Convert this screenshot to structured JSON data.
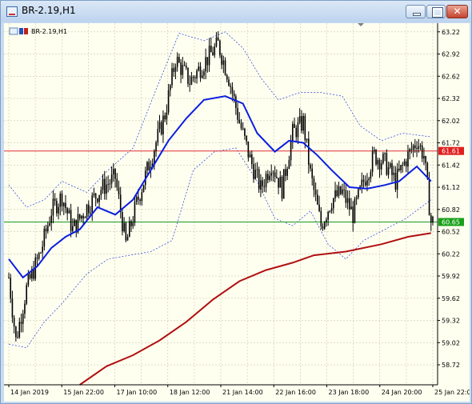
{
  "window": {
    "title": "BR-2.19,H1",
    "close_glyph": "✕"
  },
  "chart_header": {
    "symbol_label": "BR-2.19,H1",
    "icons": [
      "chart-window-icon",
      "bar-chart-icon"
    ]
  },
  "colors": {
    "background": "#fffff0",
    "grid": "#c8c8a8",
    "candle": "#000000",
    "ma_fast": "#0a1ee0",
    "ma_slow": "#b01010",
    "bands": "#1e3cdc",
    "resistance_line": "#e03030",
    "support_line": "#1a9a1a",
    "price_tag_red": "#e02020",
    "price_tag_green": "#18a018"
  },
  "chart_data": {
    "type": "candlestick",
    "title": "BR-2.19,H1",
    "y_ticks": [
      63.22,
      62.92,
      62.62,
      62.32,
      62.02,
      61.72,
      61.42,
      61.12,
      60.82,
      60.52,
      60.22,
      59.92,
      59.62,
      59.32,
      59.02,
      58.72
    ],
    "ylim": [
      58.45,
      63.25
    ],
    "x_ticks": [
      "14 Jan 2019",
      "15 Jan 22:00",
      "17 Jan 10:00",
      "18 Jan 12:00",
      "21 Jan 14:00",
      "22 Jan 16:00",
      "23 Jan 18:00",
      "24 Jan 20:00",
      "25 Jan 22:00"
    ],
    "hlines": [
      {
        "label": "61.61",
        "value": 61.61,
        "color": "#e03030"
      },
      {
        "label": "60.65",
        "value": 60.65,
        "color": "#1a9a1a"
      }
    ],
    "price_path": [
      {
        "bar": 0,
        "price": 59.9
      },
      {
        "bar": 4,
        "price": 59.05
      },
      {
        "bar": 10,
        "price": 59.75
      },
      {
        "bar": 18,
        "price": 60.25
      },
      {
        "bar": 24,
        "price": 60.8
      },
      {
        "bar": 30,
        "price": 61.0
      },
      {
        "bar": 36,
        "price": 60.55
      },
      {
        "bar": 44,
        "price": 60.85
      },
      {
        "bar": 52,
        "price": 61.1
      },
      {
        "bar": 60,
        "price": 61.25
      },
      {
        "bar": 66,
        "price": 60.35
      },
      {
        "bar": 72,
        "price": 60.9
      },
      {
        "bar": 80,
        "price": 61.5
      },
      {
        "bar": 88,
        "price": 62.1
      },
      {
        "bar": 94,
        "price": 62.85
      },
      {
        "bar": 102,
        "price": 62.55
      },
      {
        "bar": 110,
        "price": 62.8
      },
      {
        "bar": 118,
        "price": 63.05
      },
      {
        "bar": 124,
        "price": 62.6
      },
      {
        "bar": 130,
        "price": 62.0
      },
      {
        "bar": 136,
        "price": 61.5
      },
      {
        "bar": 142,
        "price": 61.1
      },
      {
        "bar": 148,
        "price": 61.45
      },
      {
        "bar": 154,
        "price": 61.1
      },
      {
        "bar": 160,
        "price": 61.85
      },
      {
        "bar": 166,
        "price": 62.0
      },
      {
        "bar": 170,
        "price": 61.3
      },
      {
        "bar": 176,
        "price": 60.6
      },
      {
        "bar": 182,
        "price": 60.95
      },
      {
        "bar": 188,
        "price": 61.05
      },
      {
        "bar": 194,
        "price": 60.75
      },
      {
        "bar": 200,
        "price": 61.2
      },
      {
        "bar": 206,
        "price": 61.55
      },
      {
        "bar": 212,
        "price": 61.45
      },
      {
        "bar": 218,
        "price": 61.2
      },
      {
        "bar": 224,
        "price": 61.5
      },
      {
        "bar": 230,
        "price": 61.75
      },
      {
        "bar": 234,
        "price": 61.55
      },
      {
        "bar": 238,
        "price": 60.65
      }
    ],
    "ma_fast": [
      {
        "bar": 0,
        "price": 60.15
      },
      {
        "bar": 8,
        "price": 59.9
      },
      {
        "bar": 16,
        "price": 60.05
      },
      {
        "bar": 24,
        "price": 60.3
      },
      {
        "bar": 32,
        "price": 60.45
      },
      {
        "bar": 40,
        "price": 60.55
      },
      {
        "bar": 50,
        "price": 60.85
      },
      {
        "bar": 60,
        "price": 60.75
      },
      {
        "bar": 70,
        "price": 60.95
      },
      {
        "bar": 80,
        "price": 61.35
      },
      {
        "bar": 90,
        "price": 61.75
      },
      {
        "bar": 100,
        "price": 62.05
      },
      {
        "bar": 110,
        "price": 62.3
      },
      {
        "bar": 122,
        "price": 62.35
      },
      {
        "bar": 132,
        "price": 62.25
      },
      {
        "bar": 140,
        "price": 61.85
      },
      {
        "bar": 150,
        "price": 61.6
      },
      {
        "bar": 158,
        "price": 61.75
      },
      {
        "bar": 166,
        "price": 61.72
      },
      {
        "bar": 174,
        "price": 61.55
      },
      {
        "bar": 182,
        "price": 61.35
      },
      {
        "bar": 192,
        "price": 61.12
      },
      {
        "bar": 202,
        "price": 61.1
      },
      {
        "bar": 212,
        "price": 61.15
      },
      {
        "bar": 220,
        "price": 61.2
      },
      {
        "bar": 230,
        "price": 61.4
      },
      {
        "bar": 238,
        "price": 61.2
      }
    ],
    "band_upper": [
      {
        "bar": 0,
        "price": 61.15
      },
      {
        "bar": 10,
        "price": 60.85
      },
      {
        "bar": 20,
        "price": 60.95
      },
      {
        "bar": 30,
        "price": 61.2
      },
      {
        "bar": 44,
        "price": 61.05
      },
      {
        "bar": 56,
        "price": 61.35
      },
      {
        "bar": 70,
        "price": 61.65
      },
      {
        "bar": 84,
        "price": 62.5
      },
      {
        "bar": 96,
        "price": 63.2
      },
      {
        "bar": 110,
        "price": 63.1
      },
      {
        "bar": 122,
        "price": 63.22
      },
      {
        "bar": 132,
        "price": 63.0
      },
      {
        "bar": 142,
        "price": 62.6
      },
      {
        "bar": 152,
        "price": 62.3
      },
      {
        "bar": 164,
        "price": 62.4
      },
      {
        "bar": 176,
        "price": 62.4
      },
      {
        "bar": 188,
        "price": 62.35
      },
      {
        "bar": 198,
        "price": 61.95
      },
      {
        "bar": 210,
        "price": 61.75
      },
      {
        "bar": 222,
        "price": 61.85
      },
      {
        "bar": 238,
        "price": 61.8
      }
    ],
    "band_lower": [
      {
        "bar": 0,
        "price": 59.0
      },
      {
        "bar": 10,
        "price": 58.95
      },
      {
        "bar": 20,
        "price": 59.3
      },
      {
        "bar": 30,
        "price": 59.55
      },
      {
        "bar": 44,
        "price": 59.95
      },
      {
        "bar": 56,
        "price": 60.15
      },
      {
        "bar": 68,
        "price": 60.2
      },
      {
        "bar": 80,
        "price": 60.25
      },
      {
        "bar": 92,
        "price": 60.4
      },
      {
        "bar": 104,
        "price": 61.35
      },
      {
        "bar": 116,
        "price": 61.6
      },
      {
        "bar": 128,
        "price": 61.65
      },
      {
        "bar": 140,
        "price": 61.2
      },
      {
        "bar": 150,
        "price": 60.7
      },
      {
        "bar": 160,
        "price": 60.6
      },
      {
        "bar": 170,
        "price": 60.8
      },
      {
        "bar": 180,
        "price": 60.35
      },
      {
        "bar": 190,
        "price": 60.15
      },
      {
        "bar": 200,
        "price": 60.4
      },
      {
        "bar": 212,
        "price": 60.55
      },
      {
        "bar": 224,
        "price": 60.7
      },
      {
        "bar": 238,
        "price": 60.95
      }
    ],
    "ma_slow": [
      {
        "bar": 40,
        "price": 58.45
      },
      {
        "bar": 55,
        "price": 58.7
      },
      {
        "bar": 70,
        "price": 58.85
      },
      {
        "bar": 85,
        "price": 59.05
      },
      {
        "bar": 100,
        "price": 59.3
      },
      {
        "bar": 115,
        "price": 59.6
      },
      {
        "bar": 130,
        "price": 59.85
      },
      {
        "bar": 145,
        "price": 60.0
      },
      {
        "bar": 160,
        "price": 60.1
      },
      {
        "bar": 172,
        "price": 60.2
      },
      {
        "bar": 190,
        "price": 60.25
      },
      {
        "bar": 210,
        "price": 60.35
      },
      {
        "bar": 225,
        "price": 60.45
      },
      {
        "bar": 238,
        "price": 60.5
      }
    ],
    "bar_count": 240,
    "grid": true
  }
}
